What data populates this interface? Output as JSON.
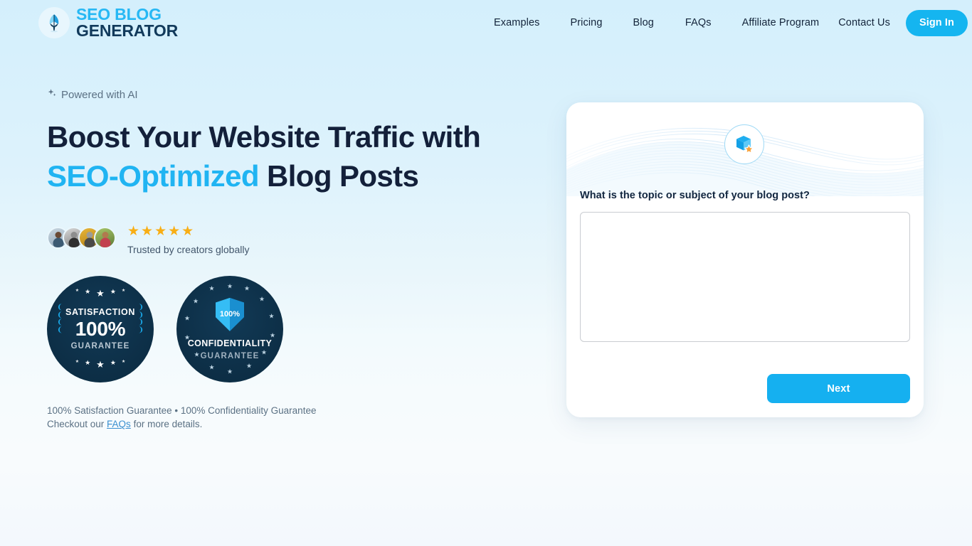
{
  "brand": {
    "icon": "quill-feather-icon",
    "line1": "SEO BLOG",
    "line2": "GENERATOR"
  },
  "nav": {
    "items": [
      {
        "label": "Examples"
      },
      {
        "label": "Pricing"
      },
      {
        "label": "Blog"
      },
      {
        "label": "FAQs"
      },
      {
        "label": "Affiliate Program"
      },
      {
        "label": "Contact Us"
      }
    ],
    "signin_label": "Sign In"
  },
  "hero": {
    "eyebrow_icon": "sparkle-icon",
    "eyebrow": "Powered with AI",
    "headline_line1": "Boost Your Website Traffic with",
    "headline_accent": "SEO-Optimized",
    "headline_line2_rest": " Blog Posts",
    "stars": "★★★★★",
    "stars_count": "5",
    "trust_text": "Trusted by creators globally",
    "avatars_count": "4"
  },
  "badges": [
    {
      "name": "satisfaction-guarantee-badge",
      "top": "SATISFACTION",
      "mid": "100%",
      "bottom": "GUARANTEE"
    },
    {
      "name": "confidentiality-guarantee-badge",
      "shield_value": "100%",
      "title": "CONFIDENTIALITY",
      "subtitle": "GUARANTEE"
    }
  ],
  "guarantee_note": {
    "line1": "100% Satisfaction Guarantee • 100% Confidentiality Guarantee",
    "line2_before": "Checkout our ",
    "link": "FAQs",
    "line2_after": " for more details."
  },
  "card": {
    "icon": "box-star-icon",
    "question": "What is the topic or subject of your blog post?",
    "topic_value": "",
    "topic_placeholder": "",
    "next_label": "Next"
  },
  "colors": {
    "accent": "#15b5f0",
    "headline_accent": "#20b4f2",
    "dark": "#12263f",
    "star": "#f8ae15",
    "badge_bg": "#0d2f47",
    "page_top_bg": "#d4effc"
  }
}
